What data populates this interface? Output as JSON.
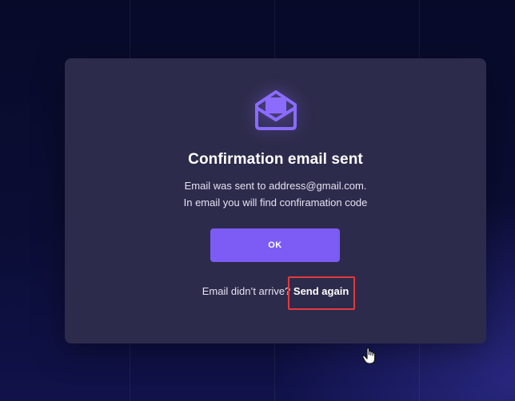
{
  "modal": {
    "icon": "envelope-open-icon",
    "title": "Confirmation email sent",
    "message_line1": "Email was sent to address@gmail.com.",
    "message_line2": "In email you will find confiramation code",
    "ok_label": "OK",
    "resend_prompt": "Email didn’t arrive?",
    "resend_link": "Send again"
  },
  "colors": {
    "background": "#0b0d34",
    "modal_bg": "#2d2b4b",
    "accent": "#7c5cf4",
    "highlight": "#e23b3b"
  },
  "cursor": {
    "icon": "hand-pointer-icon"
  }
}
